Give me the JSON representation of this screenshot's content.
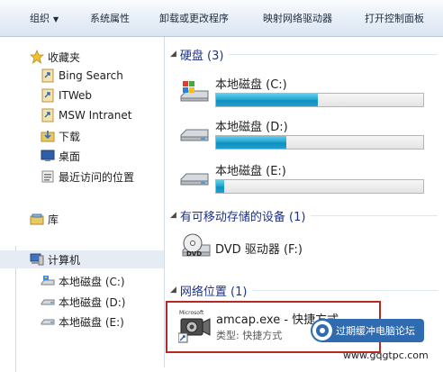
{
  "toolbar": {
    "organize": "组织",
    "system_properties": "系统属性",
    "uninstall": "卸载或更改程序",
    "map_drive": "映射网络驱动器",
    "control_panel": "打开控制面板"
  },
  "nav": {
    "favorites": "收藏夹",
    "bing": "Bing Search",
    "itweb": "ITWeb",
    "msw": "MSW Intranet",
    "downloads": "下载",
    "desktop": "桌面",
    "recent": "最近访问的位置",
    "library": "库",
    "computer": "计算机",
    "drive_c": "本地磁盘 (C:)",
    "drive_d": "本地磁盘 (D:)",
    "drive_e": "本地磁盘 (E:)"
  },
  "content": {
    "hdd_header": "硬盘 (3)",
    "removable_header": "有可移动存储的设备 (1)",
    "network_header": "网络位置 (1)",
    "drives": [
      {
        "name": "本地磁盘 (C:)",
        "used": 0.49
      },
      {
        "name": "本地磁盘 (D:)",
        "used": 0.34
      },
      {
        "name": "本地磁盘 (E:)",
        "used": 0.04
      }
    ],
    "dvd": "DVD 驱动器 (F:)",
    "dvd_label": "DVD",
    "shortcut_name": "amcap.exe - 快捷方式",
    "shortcut_type": "类型: 快捷方式",
    "shortcut_icon_text": "Microsoft"
  },
  "watermark": {
    "text": "过期缓冲电脑论坛",
    "url": "www.gqgtpc.com"
  },
  "colors": {
    "bar_fill": "#1aa1d2",
    "header_text": "#1e3287",
    "highlight_border": "#b52b23"
  }
}
